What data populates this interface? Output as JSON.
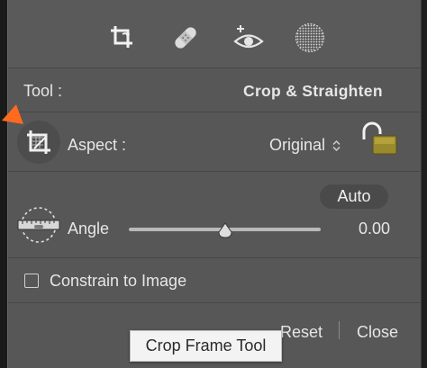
{
  "toolbar": {
    "tools": [
      {
        "icon": "crop-icon",
        "active": true
      },
      {
        "icon": "healing-bandage-icon",
        "active": false
      },
      {
        "icon": "red-eye-icon",
        "active": false
      },
      {
        "icon": "masking-circle-icon",
        "active": false
      }
    ]
  },
  "tool_row": {
    "label": "Tool :",
    "value": "Crop & Straighten"
  },
  "aspect": {
    "label": "Aspect :",
    "value": "Original",
    "lock_icon": "unlocked-padlock-icon"
  },
  "angle": {
    "auto_label": "Auto",
    "label": "Angle",
    "value": "0.00",
    "slider_fraction": 0.5
  },
  "constrain": {
    "label": "Constrain to Image",
    "checked": false
  },
  "footer": {
    "reset_label": "Reset",
    "close_label": "Close"
  },
  "tooltip": {
    "text": "Crop Frame Tool"
  },
  "colors": {
    "panel_bg": "#575757",
    "pointer": "#ff6a1f",
    "lock_body": "#9a8a2e",
    "tooltip_bg": "#f3f3f3"
  }
}
